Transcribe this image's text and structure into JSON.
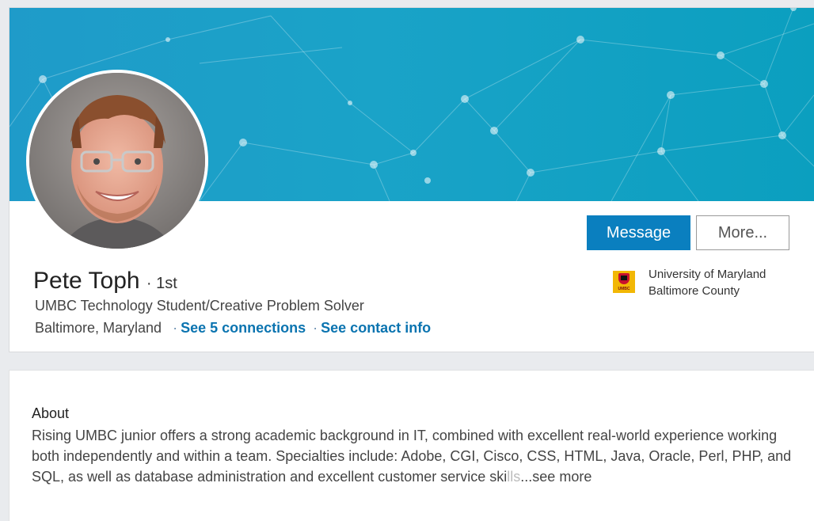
{
  "profile": {
    "name": "Pete Toph",
    "degree": "1st",
    "headline": "UMBC Technology Student/Creative Problem Solver",
    "location": "Baltimore, Maryland",
    "connections_link": "See 5 connections",
    "contact_link": "See contact info"
  },
  "actions": {
    "message_label": "Message",
    "more_label": "More..."
  },
  "education": {
    "school_line1": "University of Maryland",
    "school_line2": "Baltimore County",
    "logo_text": "UMBC"
  },
  "about": {
    "title": "About",
    "text": "Rising UMBC junior offers a strong academic background in IT, combined with excellent real-world experience working both independently and within a team. Specialties include: Adobe, CGI, Cisco, CSS, HTML, Java, Oracle, Perl, PHP, and SQL, as well as database administration and excellent customer service ski",
    "text_fade": "lls",
    "see_more": "...see more"
  },
  "colors": {
    "accent": "#0a7fbf",
    "link": "#0b74b0",
    "banner": "#1a9fc8"
  }
}
